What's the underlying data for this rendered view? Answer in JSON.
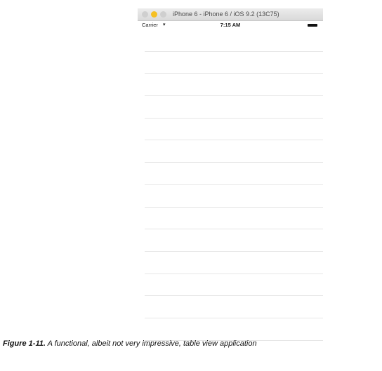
{
  "simulator": {
    "title": "iPhone 6 - iPhone 6 / iOS 9.2 (13C75)"
  },
  "status_bar": {
    "carrier": "Carrier",
    "time": "7:15 AM"
  },
  "table": {
    "row_count": 14
  },
  "caption": {
    "label": "Figure 1-11.",
    "text": "A functional, albeit not very impressive, table view application"
  },
  "colors": {
    "minimize_light": "#f5c024",
    "separator": "#e6e6e6"
  }
}
